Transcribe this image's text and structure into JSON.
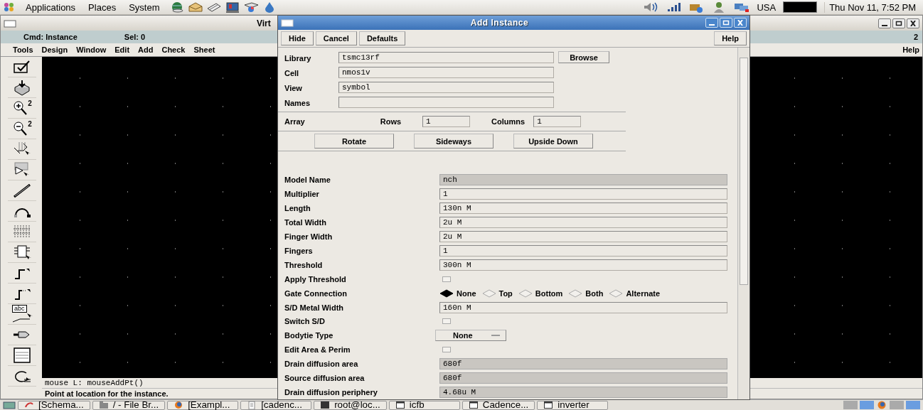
{
  "top_panel": {
    "menus": [
      "Applications",
      "Places",
      "System"
    ],
    "keyboard": "USA",
    "clock": "Thu Nov 11,  7:52 PM"
  },
  "editor": {
    "title": "Virt",
    "cmd": "Cmd: Instance",
    "sel": "Sel: 0",
    "count": "2",
    "menus": [
      "Tools",
      "Design",
      "Window",
      "Edit",
      "Add",
      "Check",
      "Sheet"
    ],
    "help": "Help",
    "tools": [
      {
        "kind": "check"
      },
      {
        "kind": "box"
      },
      {
        "kind": "zoom-in",
        "text": "2"
      },
      {
        "kind": "zoom-out",
        "text": "2"
      },
      {
        "kind": "stretch"
      },
      {
        "kind": "copy"
      },
      {
        "kind": "wire"
      },
      {
        "kind": "arc"
      },
      {
        "kind": "bus"
      },
      {
        "kind": "instance"
      },
      {
        "kind": "pin"
      },
      {
        "kind": "pin2"
      },
      {
        "kind": "label",
        "text": "abc"
      },
      {
        "kind": "port"
      },
      {
        "kind": "sheet"
      },
      {
        "kind": "loop"
      }
    ],
    "prompt": "mouse L: mouseAddPt()",
    "message": "Point at location for the instance."
  },
  "dialog": {
    "title": "Add Instance",
    "buttons": [
      "Hide",
      "Cancel",
      "Defaults"
    ],
    "help": "Help",
    "library": {
      "label": "Library",
      "value": "tsmc13rf",
      "button": "Browse"
    },
    "cell": {
      "label": "Cell",
      "value": "nmos1v"
    },
    "view": {
      "label": "View",
      "value": "symbol"
    },
    "names": {
      "label": "Names"
    },
    "array": {
      "label": "Array",
      "rows_label": "Rows",
      "rows": "1",
      "columns_label": "Columns",
      "columns": "1"
    },
    "orient_buttons": [
      "Rotate",
      "Sideways",
      "Upside Down"
    ],
    "params": [
      {
        "kind": "readonly",
        "label": "Model Name",
        "value": "nch"
      },
      {
        "kind": "field",
        "label": "Multiplier",
        "value": "1"
      },
      {
        "kind": "field",
        "label": "Length",
        "value": "130n M"
      },
      {
        "kind": "field",
        "label": "Total Width",
        "value": "2u M"
      },
      {
        "kind": "field",
        "label": "Finger Width",
        "value": "2u M"
      },
      {
        "kind": "field",
        "label": "Fingers",
        "value": "1"
      },
      {
        "kind": "field",
        "label": "Threshold",
        "value": "300n M"
      },
      {
        "kind": "checkbox",
        "label": "Apply Threshold",
        "checked": false
      },
      {
        "kind": "radio",
        "label": "Gate Connection",
        "options": [
          {
            "label": "None",
            "selected": true
          },
          {
            "label": "Top",
            "selected": false
          },
          {
            "label": "Bottom",
            "selected": false
          },
          {
            "label": "Both",
            "selected": false
          },
          {
            "label": "Alternate",
            "selected": false
          }
        ]
      },
      {
        "kind": "field",
        "label": "S/D Metal Width",
        "value": "160n M"
      },
      {
        "kind": "checkbox",
        "label": "Switch S/D",
        "checked": false
      },
      {
        "kind": "dropdown",
        "label": "Bodytie Type",
        "value": "None"
      },
      {
        "kind": "checkbox",
        "label": "Edit Area & Perim",
        "checked": false
      },
      {
        "kind": "readonly",
        "label": "Drain diffusion area",
        "value": "680f"
      },
      {
        "kind": "readonly",
        "label": "Source diffusion area",
        "value": "680f"
      },
      {
        "kind": "readonly",
        "label": "Drain diffusion periphery",
        "value": "4.68u M"
      }
    ]
  },
  "taskbar": [
    {
      "kind": "editor",
      "label": "[Schema..."
    },
    {
      "kind": "folder",
      "label": "/ - File Br..."
    },
    {
      "kind": "browser",
      "label": "[Exampl..."
    },
    {
      "kind": "document",
      "label": "[cadenc..."
    },
    {
      "kind": "terminal",
      "label": "root@loc..."
    },
    {
      "kind": "window",
      "label": "icfb"
    },
    {
      "kind": "window",
      "label": "Cadence..."
    },
    {
      "kind": "window",
      "label": "inverter"
    }
  ]
}
